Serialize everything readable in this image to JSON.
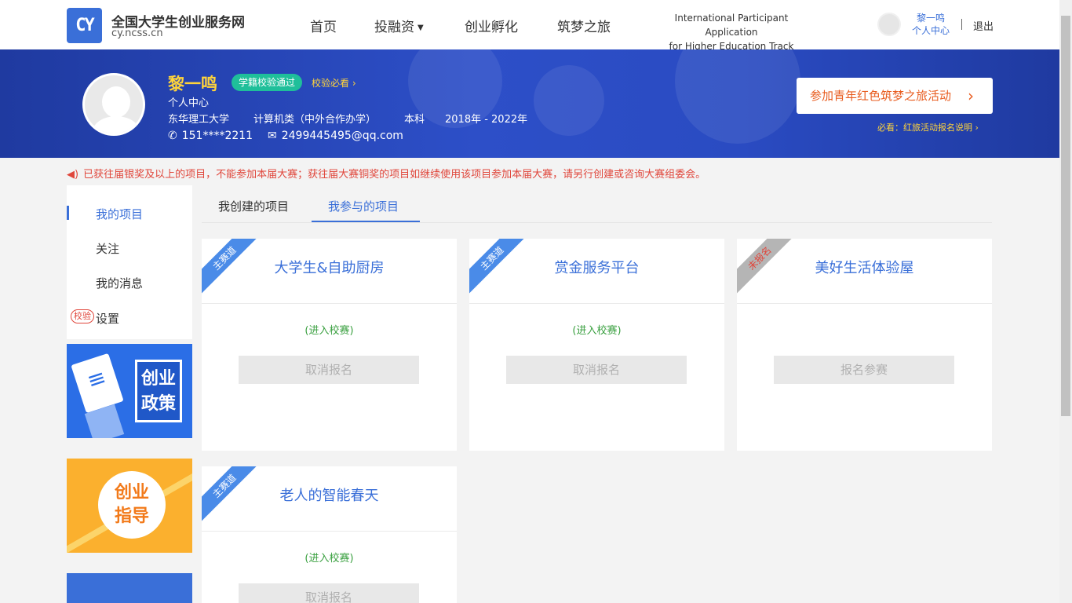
{
  "header": {
    "logo_mark": "CY",
    "logo_title": "全国大学生创业服务网",
    "logo_sub": "cy.ncss.cn",
    "nav": [
      "首页",
      "投融资",
      "创业孵化",
      "筑梦之旅"
    ],
    "intl_line1": "International Participant Application",
    "intl_line2": "for Higher Education Track",
    "user_name": "黎一鸣",
    "user_center": "个人中心",
    "logout": "退出"
  },
  "banner": {
    "name": "黎一鸣",
    "badge": "学籍校验通过",
    "verify_link": "校验必看",
    "center": "个人中心",
    "school": "东华理工大学",
    "major": "计算机类（中外合作办学）",
    "degree": "本科",
    "period": "2018年 - 2022年",
    "phone": "151****2211",
    "email": "2499445495@qq.com",
    "join_btn": "参加青年红色筑梦之旅活动",
    "join_note": "必看：红旅活动报名说明"
  },
  "notice": "已获往届银奖及以上的项目，不能参加本届大赛；获往届大赛铜奖的项目如继续使用该项目参加本届大赛，请另行创建或咨询大赛组委会。",
  "sidebar": {
    "items": [
      "我的项目",
      "关注",
      "我的消息",
      "设置"
    ],
    "verify_tag": "校验",
    "promo1": "创业政策",
    "promo1_l1": "创业",
    "promo1_l2": "政策",
    "promo2_l1": "创业",
    "promo2_l2": "指导"
  },
  "tabs": [
    "我创建的项目",
    "我参与的项目"
  ],
  "projects": [
    {
      "ribbon": "主赛道",
      "title": "大学生&自助厨房",
      "status": "(进入校赛)",
      "button": "取消报名"
    },
    {
      "ribbon": "主赛道",
      "title": "赏金服务平台",
      "status": "(进入校赛)",
      "button": "取消报名"
    },
    {
      "ribbon": "未报名",
      "title": "美好生活体验屋",
      "status": "",
      "button": "报名参赛"
    },
    {
      "ribbon": "主赛道",
      "title": "老人的智能春天",
      "status": "(进入校赛)",
      "button": "取消报名"
    }
  ],
  "colors": {
    "brand": "#3a6fd8",
    "banner": "#2d4fc8",
    "accent_yellow": "#ffd43b",
    "notice_red": "#e0463b",
    "status_green": "#3aa040"
  },
  "icons": [
    "phone-icon",
    "mail-icon",
    "speaker-icon",
    "chevron-right-icon",
    "caret-down-icon"
  ]
}
